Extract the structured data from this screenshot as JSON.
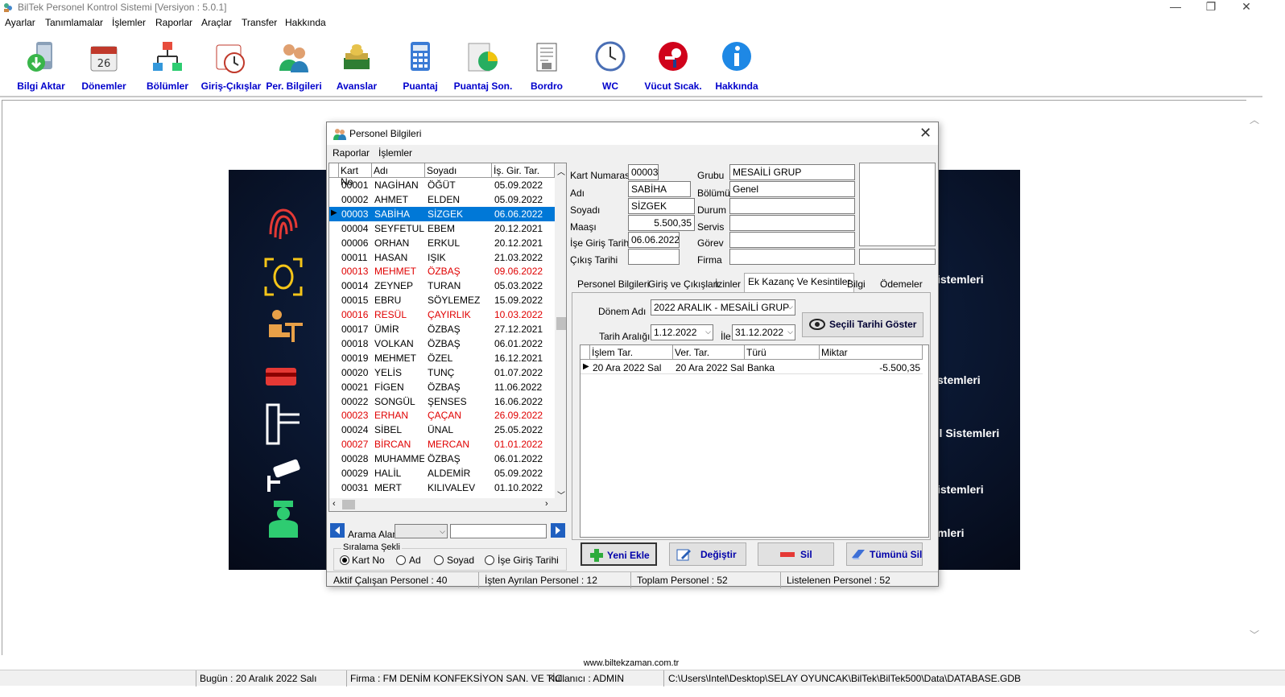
{
  "window": {
    "title": "BilTek Personel Kontrol Sistemi [Versiyon : 5.0.1]"
  },
  "menu": [
    "Ayarlar",
    "Tanımlamalar",
    "İşlemler",
    "Raporlar",
    "Araçlar",
    "Transfer",
    "Hakkında"
  ],
  "toolbar": [
    {
      "label": "Bilgi Aktar",
      "icon": "data-transfer-icon"
    },
    {
      "label": "Dönemler",
      "icon": "calendar-icon"
    },
    {
      "label": "Bölümler",
      "icon": "org-chart-icon"
    },
    {
      "label": "Giriş-Çıkışlar",
      "icon": "clock-icon"
    },
    {
      "label": "Per. Bilgileri",
      "icon": "people-icon"
    },
    {
      "label": "Avanslar",
      "icon": "money-icon"
    },
    {
      "label": "Puantaj",
      "icon": "calculator-icon"
    },
    {
      "label": "Puantaj Son.",
      "icon": "pie-chart-icon"
    },
    {
      "label": "Bordro",
      "icon": "document-icon"
    },
    {
      "label": "WC",
      "icon": "wall-clock-icon"
    },
    {
      "label": "Vücut Sıcak.",
      "icon": "thermometer-icon"
    },
    {
      "label": "Hakkında",
      "icon": "info-icon"
    }
  ],
  "banner": {
    "texts": [
      "istemleri",
      "stemleri",
      "ol Sistemleri",
      "istemleri",
      "mleri"
    ]
  },
  "dialog": {
    "title": "Personel Bilgileri",
    "menu": [
      "Raporlar",
      "İşlemler"
    ],
    "grid_headers": [
      "Kart No",
      "Adı",
      "Soyadı",
      "İş. Gir. Tar."
    ],
    "rows": [
      {
        "no": "00001",
        "ad": "NAGİHAN",
        "soyad": "ÖĞÜT",
        "tarih": "05.09.2022",
        "state": ""
      },
      {
        "no": "00002",
        "ad": "AHMET",
        "soyad": "ELDEN",
        "tarih": "05.09.2022",
        "state": ""
      },
      {
        "no": "00003",
        "ad": "SABİHA",
        "soyad": "SİZGEK",
        "tarih": "06.06.2022",
        "state": "selected"
      },
      {
        "no": "00004",
        "ad": "SEYFETULLAH",
        "soyad": "EBEM",
        "tarih": "20.12.2021",
        "state": ""
      },
      {
        "no": "00006",
        "ad": "ORHAN",
        "soyad": "ERKUL",
        "tarih": "20.12.2021",
        "state": ""
      },
      {
        "no": "00011",
        "ad": "HASAN",
        "soyad": "IŞIK",
        "tarih": "21.03.2022",
        "state": ""
      },
      {
        "no": "00013",
        "ad": "MEHMET",
        "soyad": "ÖZBAŞ",
        "tarih": "09.06.2022",
        "state": "red"
      },
      {
        "no": "00014",
        "ad": "ZEYNEP",
        "soyad": "TURAN",
        "tarih": "05.03.2022",
        "state": ""
      },
      {
        "no": "00015",
        "ad": "EBRU",
        "soyad": "SÖYLEMEZ",
        "tarih": "15.09.2022",
        "state": ""
      },
      {
        "no": "00016",
        "ad": "RESÜL",
        "soyad": "ÇAYIRLIK",
        "tarih": "10.03.2022",
        "state": "red"
      },
      {
        "no": "00017",
        "ad": "ÜMİR",
        "soyad": "ÖZBAŞ",
        "tarih": "27.12.2021",
        "state": ""
      },
      {
        "no": "00018",
        "ad": "VOLKAN",
        "soyad": "ÖZBAŞ",
        "tarih": "06.01.2022",
        "state": ""
      },
      {
        "no": "00019",
        "ad": "MEHMET",
        "soyad": "ÖZEL",
        "tarih": "16.12.2021",
        "state": ""
      },
      {
        "no": "00020",
        "ad": "YELİS",
        "soyad": "TUNÇ",
        "tarih": "01.07.2022",
        "state": ""
      },
      {
        "no": "00021",
        "ad": "FİGEN",
        "soyad": "ÖZBAŞ",
        "tarih": "11.06.2022",
        "state": ""
      },
      {
        "no": "00022",
        "ad": "SONGÜL",
        "soyad": "ŞENSES",
        "tarih": "16.06.2022",
        "state": ""
      },
      {
        "no": "00023",
        "ad": "ERHAN",
        "soyad": "ÇAÇAN",
        "tarih": "26.09.2022",
        "state": "red"
      },
      {
        "no": "00024",
        "ad": "SİBEL",
        "soyad": "ÜNAL",
        "tarih": "25.05.2022",
        "state": ""
      },
      {
        "no": "00027",
        "ad": "BİRCAN",
        "soyad": "MERCAN",
        "tarih": "01.01.2022",
        "state": "red"
      },
      {
        "no": "00028",
        "ad": "MUHAMMET",
        "soyad": "ÖZBAŞ",
        "tarih": "06.01.2022",
        "state": ""
      },
      {
        "no": "00029",
        "ad": "HALİL",
        "soyad": "ALDEMİR",
        "tarih": "05.09.2022",
        "state": ""
      },
      {
        "no": "00031",
        "ad": "MERT",
        "soyad": "KILIVALEV",
        "tarih": "01.10.2022",
        "state": ""
      }
    ],
    "search_label": "Arama Alanı",
    "sort": {
      "legend": "Sıralama Şekli",
      "options": [
        "Kart No",
        "Ad",
        "Soyad",
        "İşe Giriş Tarihi"
      ],
      "selected": "Kart No"
    },
    "fields": {
      "kart_label": "Kart Numarası",
      "kart": "00003",
      "adi_label": "Adı",
      "adi": "SABİHA",
      "soyadi_label": "Soyadı",
      "soyadi": "SİZGEK",
      "maas_label": "Maaşı",
      "maas": "5.500,35",
      "ise_giris_label": "İşe Giriş Tarihi",
      "ise_giris": "06.06.2022",
      "cikis_label": "Çıkış Tarihi",
      "cikis": "",
      "grubu_label": "Grubu",
      "grubu": "MESAİLİ GRUP",
      "bolumu_label": "Bölümü",
      "bolumu": "Genel",
      "durum_label": "Durum",
      "durum": "",
      "servis_label": "Servis",
      "servis": "",
      "gorev_label": "Görev",
      "gorev": "",
      "firma_label": "Firma",
      "firma": ""
    },
    "tabs": [
      "Personel Bilgileri",
      "Giriş ve Çıkışları",
      "İzinler",
      "Ek Kazanç Ve Kesintiler",
      "Bilgi",
      "Ödemeler"
    ],
    "active_tab": "Ek Kazanç Ve Kesintiler",
    "donem_label": "Dönem Adı",
    "donem": "2022 ARALIK - MESAİLİ GRUP",
    "tarih_araligi_label": "Tarih Aralığı",
    "tarih_bas": "1.12.2022",
    "ile": "İle",
    "tarih_bit": "31.12.2022",
    "show_dates_btn": "Seçili Tarihi Göster",
    "inner_headers": [
      "İşlem Tar.",
      "Ver. Tar.",
      "Türü",
      "Miktar"
    ],
    "inner_rows": [
      {
        "islem": "20 Ara 2022 Sal",
        "ver": "20 Ara 2022 Sal",
        "tur": "Banka",
        "miktar": "-5.500,35"
      }
    ],
    "buttons": {
      "add": "Yeni Ekle",
      "edit": "Değiştir",
      "del": "Sil",
      "del_all": "Tümünü Sil"
    },
    "status": [
      "Aktif Çalışan Personel : 40",
      "İşten Ayrılan Personel : 12",
      "Toplam Personel : 52",
      "Listelenen Personel : 52"
    ]
  },
  "url": "www.biltekzaman.com.tr",
  "statusbar": [
    "Bugün : 20 Aralık 2022 Salı",
    "Firma : FM DENİM KONFEKSİYON SAN. VE TİC.",
    "Kullanıcı : ADMIN",
    "C:\\Users\\Intel\\Desktop\\SELAY OYUNCAK\\BilTek\\BilTek500\\Data\\DATABASE.GDB"
  ],
  "colors": {
    "accent": "#0078d7",
    "toolbar_label": "#0000cc",
    "red_row": "#e00000"
  }
}
